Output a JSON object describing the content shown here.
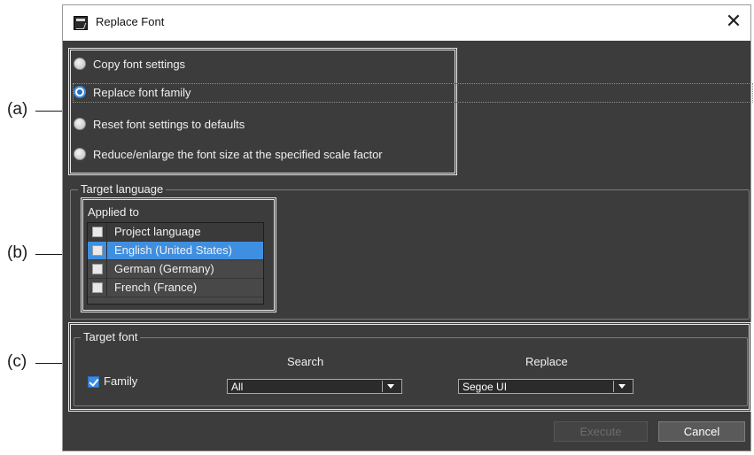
{
  "callouts": {
    "a": "(a)",
    "b": "(b)",
    "c": "(c)"
  },
  "window": {
    "title": "Replace Font",
    "close_glyph": "✕"
  },
  "options": [
    {
      "label": "Copy font settings",
      "checked": false
    },
    {
      "label": "Replace font family",
      "checked": true
    },
    {
      "label": "Reset font settings to defaults",
      "checked": false
    },
    {
      "label": "Reduce/enlarge the font size at the specified scale factor",
      "checked": false
    }
  ],
  "target_language": {
    "legend": "Target language",
    "applied_to_label": "Applied to",
    "rows": [
      {
        "label": "Project language",
        "header": true,
        "selected": false
      },
      {
        "label": "English (United States)",
        "header": false,
        "selected": true
      },
      {
        "label": "German (Germany)",
        "header": false,
        "selected": false
      },
      {
        "label": "French (France)",
        "header": false,
        "selected": false
      }
    ]
  },
  "target_font": {
    "legend": "Target font",
    "search_header": "Search",
    "replace_header": "Replace",
    "family_label": "Family",
    "family_checked": true,
    "search_value": "All",
    "replace_value": "Segoe UI"
  },
  "buttons": {
    "execute": "Execute",
    "cancel": "Cancel",
    "execute_enabled": false
  },
  "colors": {
    "dialog_bg": "#3c3c3c",
    "accent": "#3f8fe0",
    "text": "#f0f0f0"
  },
  "icons": {
    "window_icon": "app-window-icon",
    "close": "close-icon",
    "dropdown": "chevron-down-icon",
    "check": "checkmark-icon"
  }
}
